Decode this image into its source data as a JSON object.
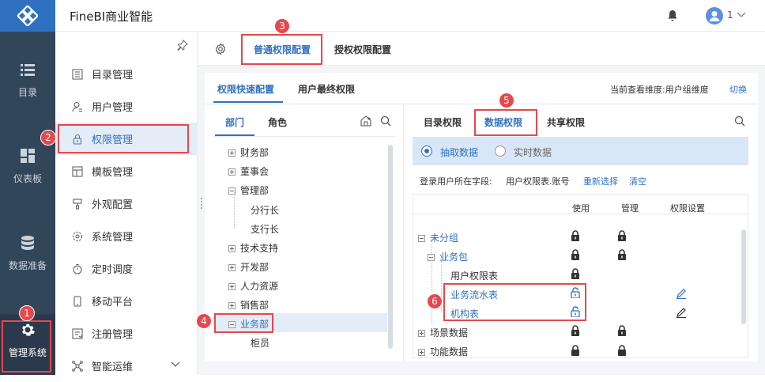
{
  "app_title": "FineBI商业智能",
  "header": {
    "user": "1"
  },
  "rail": {
    "items": [
      {
        "label": "目录"
      },
      {
        "label": "仪表板"
      },
      {
        "label": "数据准备"
      },
      {
        "label": "管理系统"
      }
    ]
  },
  "menu": {
    "items": [
      {
        "label": "目录管理"
      },
      {
        "label": "用户管理"
      },
      {
        "label": "权限管理"
      },
      {
        "label": "模板管理"
      },
      {
        "label": "外观配置"
      },
      {
        "label": "系统管理"
      },
      {
        "label": "定时调度"
      },
      {
        "label": "移动平台"
      },
      {
        "label": "注册管理"
      },
      {
        "label": "智能运维"
      }
    ]
  },
  "top_tabs": {
    "normal": "普通权限配置",
    "grant": "授权权限配置"
  },
  "sub_tabs": {
    "quick": "权限快速配置",
    "final": "用户最终权限"
  },
  "dimension": {
    "label": "当前查看维度:用户组维度",
    "switch": "切换"
  },
  "left_panel": {
    "tabs": {
      "dept": "部门",
      "role": "角色"
    },
    "tree": [
      "财务部",
      "董事会",
      "管理部",
      "分行长",
      "支行长",
      "技术支持",
      "开发部",
      "人力资源",
      "销售部",
      "业务部",
      "柜员"
    ]
  },
  "right_panel": {
    "tabs": {
      "catalog": "目录权限",
      "data": "数据权限",
      "share": "共享权限"
    },
    "radio": {
      "extract": "抽取数据",
      "realtime": "实时数据"
    },
    "login_field": {
      "label": "登录用户所在字段:",
      "value": "用户权限表.账号",
      "reselect": "重新选择",
      "clear": "清空"
    },
    "columns": {
      "use": "使用",
      "manage": "管理",
      "setting": "权限设置"
    },
    "tree": [
      "未分组",
      "业务包",
      "用户权限表",
      "业务流水表",
      "机构表",
      "场景数据",
      "功能数据"
    ]
  },
  "badges": [
    "1",
    "2",
    "3",
    "4",
    "5",
    "6"
  ]
}
